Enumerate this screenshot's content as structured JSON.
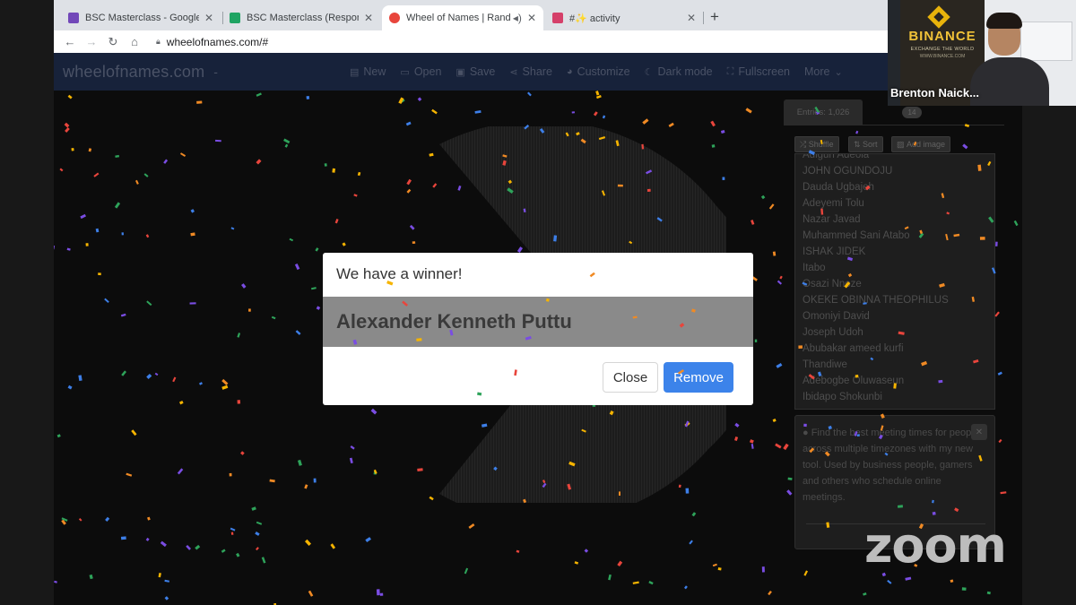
{
  "browser": {
    "tabs": [
      {
        "title": "BSC Masterclass - Google Forms",
        "color": "#7248b9"
      },
      {
        "title": "BSC Masterclass (Responses)",
        "color": "#1fa463"
      },
      {
        "title": "Wheel of Names | Random name picker",
        "color": "#e8453c"
      },
      {
        "title": "#✨ activity",
        "color": "#d5406a"
      }
    ],
    "new_tab_glyph": "+",
    "url": "wheelofnames.com/#"
  },
  "site": {
    "brand": "wheelofnames.com",
    "brand_dash": "-",
    "menu": [
      {
        "label": "New",
        "icon": "file-icon"
      },
      {
        "label": "Open",
        "icon": "folder-icon"
      },
      {
        "label": "Save",
        "icon": "save-icon"
      },
      {
        "label": "Share",
        "icon": "share-icon"
      },
      {
        "label": "Customize",
        "icon": "palette-icon"
      },
      {
        "label": "Dark mode",
        "icon": "moon-icon"
      },
      {
        "label": "Fullscreen",
        "icon": "fullscreen-icon"
      },
      {
        "label": "More",
        "icon": "chevron-down-icon"
      }
    ]
  },
  "panel": {
    "entries_tab": "Entries: 1,026",
    "results_badge": "14",
    "shuffle": "Shuffle",
    "sort": "Sort",
    "add_image": "Add image",
    "names": [
      "Adigun Adeola",
      "JOHN OGUNDOJU",
      "Dauda Ugbajeh",
      "Adeyemi Tolu",
      "Nazar Javad",
      "Muhammed Sani Atabo",
      "ISHAK JIDEK",
      "Itabo",
      "Osazi Nnoze",
      "OKEKE OBINNA THEOPHILUS",
      "Omoniyi David",
      "Joseph Udoh",
      "Abubakar ameed kurfi",
      "Thandiwe",
      "Adebogbe Oluwaseun",
      "Ibidapo Shokunbi"
    ],
    "ad_text": "Find the best meeting times for people across multiple timezones with my new tool. Used by business people, gamers and others who schedule online meetings."
  },
  "modal": {
    "heading": "We have a winner!",
    "winner": "Alexander Kenneth Puttu",
    "close_label": "Close",
    "remove_label": "Remove"
  },
  "zoom": {
    "participant_name": "Brenton Naick...",
    "banner_brand": "BINANCE",
    "banner_tagline": "EXCHANGE THE WORLD",
    "banner_url": "WWW.BINANCE.COM",
    "watermark": "zoom"
  },
  "colors": {
    "accent": "#3c83ea",
    "nav_bg": "#17223a",
    "confetti": [
      "#e8453c",
      "#f6b400",
      "#3d7fe8",
      "#2ea35a",
      "#7a4de3",
      "#f08a24"
    ]
  }
}
